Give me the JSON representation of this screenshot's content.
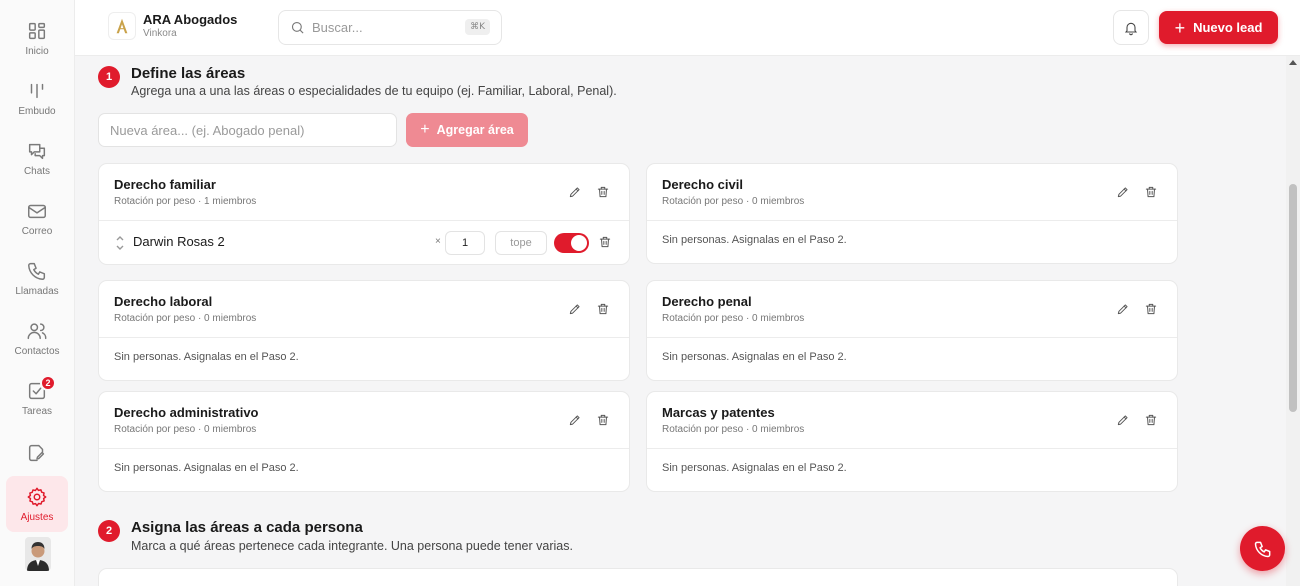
{
  "sidebar": {
    "items": [
      {
        "label": "Inicio",
        "icon": "grid-icon"
      },
      {
        "label": "Embudo",
        "icon": "funnel-icon"
      },
      {
        "label": "Chats",
        "icon": "chat-icon"
      },
      {
        "label": "Correo",
        "icon": "mail-icon"
      },
      {
        "label": "Llamadas",
        "icon": "phone-icon"
      },
      {
        "label": "Contactos",
        "icon": "users-icon"
      },
      {
        "label": "Tareas",
        "icon": "tasks-icon",
        "badge": "2"
      },
      {
        "label": "",
        "icon": "edit-document-icon"
      },
      {
        "label": "Ajustes",
        "icon": "gear-icon",
        "active": true
      }
    ]
  },
  "header": {
    "brand_name": "ARA Abogados",
    "brand_sub": "Vinkora",
    "search_placeholder": "Buscar...",
    "search_shortcut": "⌘K",
    "new_lead_label": "Nuevo lead"
  },
  "step1": {
    "number": "1",
    "title": "Define las áreas",
    "description": "Agrega una a una las áreas o especialidades de tu equipo (ej. Familiar, Laboral, Penal).",
    "input_placeholder": "Nueva área... (ej. Abogado penal)",
    "add_label": "Agregar área"
  },
  "areas": [
    {
      "name": "Derecho familiar",
      "sub": "Rotación por peso · 1 miembros",
      "members": [
        {
          "name": "Darwin Rosas 2",
          "times": "×",
          "weight": "1",
          "cap": "tope",
          "enabled": true
        }
      ]
    },
    {
      "name": "Derecho civil",
      "sub": "Rotación por peso · 0 miembros",
      "empty": "Sin personas. Asignalas en el Paso 2."
    },
    {
      "name": "Derecho laboral",
      "sub": "Rotación por peso · 0 miembros",
      "empty": "Sin personas. Asignalas en el Paso 2."
    },
    {
      "name": "Derecho penal",
      "sub": "Rotación por peso · 0 miembros",
      "empty": "Sin personas. Asignalas en el Paso 2."
    },
    {
      "name": "Derecho administrativo",
      "sub": "Rotación por peso · 0 miembros",
      "empty": "Sin personas. Asignalas en el Paso 2."
    },
    {
      "name": "Marcas y patentes",
      "sub": "Rotación por peso · 0 miembros",
      "empty": "Sin personas. Asignalas en el Paso 2."
    }
  ],
  "step2": {
    "number": "2",
    "title": "Asigna las áreas a cada persona",
    "description": "Marca a qué áreas pertenece cada integrante. Una persona puede tener varias."
  },
  "colors": {
    "accent": "#e01b2c",
    "accent_light": "#ef8a93",
    "active_bg": "#fde7ea"
  }
}
